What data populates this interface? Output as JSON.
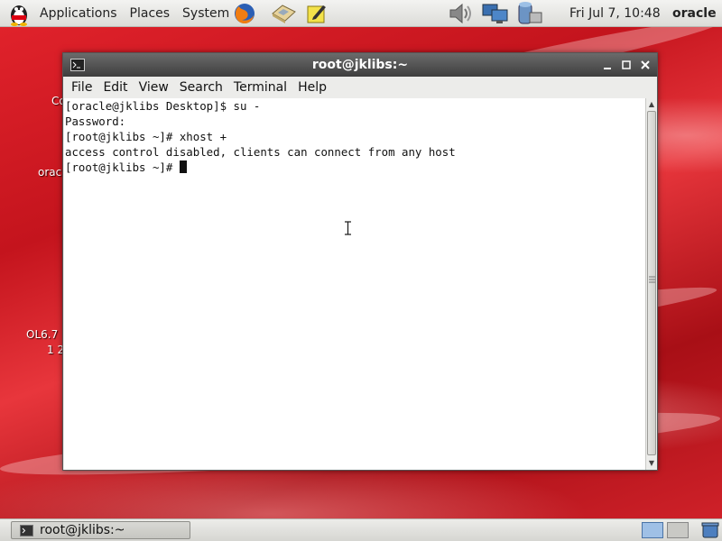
{
  "top_panel": {
    "menus": [
      "Applications",
      "Places",
      "System"
    ],
    "clock": "Fri Jul  7, 10:48",
    "user": "oracle"
  },
  "desktop": {
    "icon_label_fragments": [
      "Co",
      "orac",
      "OL6.7",
      "1 2"
    ]
  },
  "terminal": {
    "title": "root@jklibs:~",
    "menu": [
      "File",
      "Edit",
      "View",
      "Search",
      "Terminal",
      "Help"
    ],
    "lines": [
      "[oracle@jklibs Desktop]$ su -",
      "Password:",
      "[root@jklibs ~]# xhost +",
      "access control disabled, clients can connect from any host",
      "[root@jklibs ~]# "
    ]
  },
  "taskbar": {
    "window_label": "root@jklibs:~"
  },
  "colors": {
    "desktop_red": "#c4141d",
    "titlebar": "#4a4a4a",
    "panel": "#e6e6e3"
  }
}
